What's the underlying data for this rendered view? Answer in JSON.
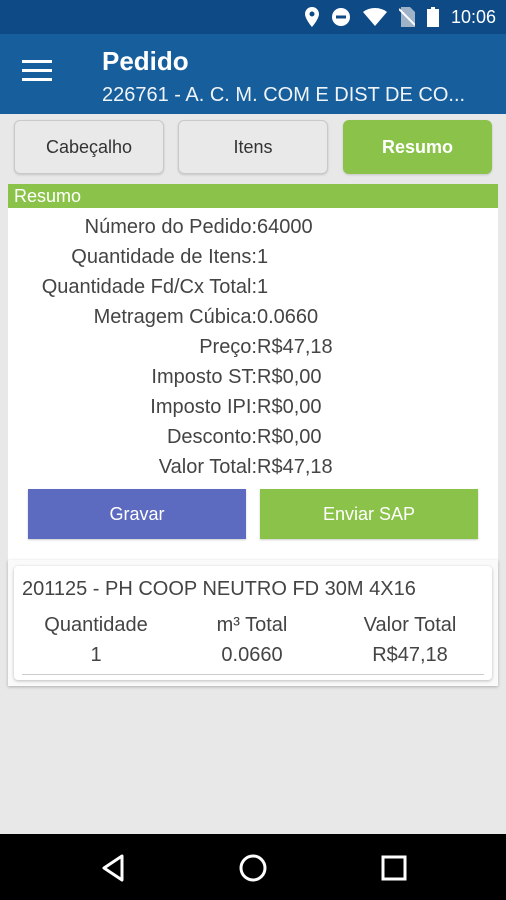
{
  "status_bar": {
    "time": "10:06",
    "icons": [
      "location-icon",
      "do-not-disturb-icon",
      "wifi-icon",
      "no-sim-icon",
      "battery-icon"
    ]
  },
  "app_bar": {
    "title": "Pedido",
    "subtitle": "226761 - A. C. M. COM E DIST DE CO..."
  },
  "tabs": [
    {
      "label": "Cabeçalho",
      "active": false
    },
    {
      "label": "Itens",
      "active": false
    },
    {
      "label": "Resumo",
      "active": true
    }
  ],
  "resumo": {
    "header": "Resumo",
    "rows": [
      {
        "label": "Número do Pedido:",
        "value": "64000"
      },
      {
        "label": "Quantidade de Itens:",
        "value": "1"
      },
      {
        "label": "Quantidade Fd/Cx Total:",
        "value": "1"
      },
      {
        "label": "Metragem Cúbica:",
        "value": "0.0660"
      },
      {
        "label": "Preço:",
        "value": "R$47,18"
      },
      {
        "label": "Imposto ST:",
        "value": "R$0,00"
      },
      {
        "label": "Imposto IPI:",
        "value": "R$0,00"
      },
      {
        "label": "Desconto:",
        "value": "R$0,00"
      },
      {
        "label": "Valor Total:",
        "value": "R$47,18"
      }
    ],
    "buttons": {
      "save": "Gravar",
      "send": "Enviar SAP"
    }
  },
  "item": {
    "title": "201125 - PH COOP NEUTRO FD 30M 4X16",
    "columns": [
      "Quantidade",
      "m³ Total",
      "Valor Total"
    ],
    "values": [
      "1",
      "0.0660",
      "R$47,18"
    ]
  },
  "colors": {
    "status_bar": "#0d4a86",
    "app_bar": "#175f9c",
    "accent_green": "#8bc34a",
    "button_blue": "#5c6bc0"
  }
}
